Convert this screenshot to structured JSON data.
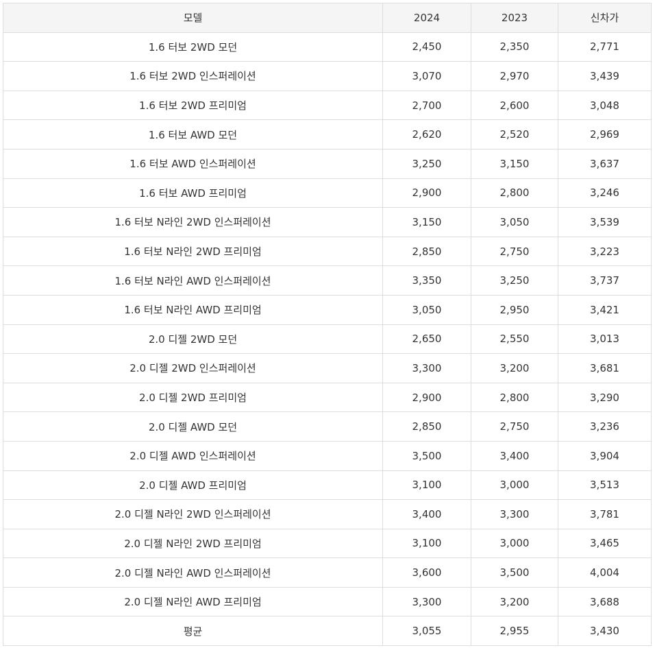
{
  "table": {
    "headers": [
      "모델",
      "2024",
      "2023",
      "신차가"
    ],
    "rows": [
      [
        "1.6 터보 2WD 모던",
        "2,450",
        "2,350",
        "2,771"
      ],
      [
        "1.6 터보 2WD 인스퍼레이션",
        "3,070",
        "2,970",
        "3,439"
      ],
      [
        "1.6 터보 2WD 프리미엄",
        "2,700",
        "2,600",
        "3,048"
      ],
      [
        "1.6 터보 AWD 모던",
        "2,620",
        "2,520",
        "2,969"
      ],
      [
        "1.6 터보 AWD 인스퍼레이션",
        "3,250",
        "3,150",
        "3,637"
      ],
      [
        "1.6 터보 AWD 프리미엄",
        "2,900",
        "2,800",
        "3,246"
      ],
      [
        "1.6 터보 N라인 2WD 인스퍼레이션",
        "3,150",
        "3,050",
        "3,539"
      ],
      [
        "1.6 터보 N라인 2WD 프리미엄",
        "2,850",
        "2,750",
        "3,223"
      ],
      [
        "1.6 터보 N라인 AWD 인스퍼레이션",
        "3,350",
        "3,250",
        "3,737"
      ],
      [
        "1.6 터보 N라인 AWD 프리미엄",
        "3,050",
        "2,950",
        "3,421"
      ],
      [
        "2.0 디젤 2WD 모던",
        "2,650",
        "2,550",
        "3,013"
      ],
      [
        "2.0 디젤 2WD 인스퍼레이션",
        "3,300",
        "3,200",
        "3,681"
      ],
      [
        "2.0 디젤 2WD 프리미엄",
        "2,900",
        "2,800",
        "3,290"
      ],
      [
        "2.0 디젤 AWD 모던",
        "2,850",
        "2,750",
        "3,236"
      ],
      [
        "2.0 디젤 AWD 인스퍼레이션",
        "3,500",
        "3,400",
        "3,904"
      ],
      [
        "2.0 디젤 AWD 프리미엄",
        "3,100",
        "3,000",
        "3,513"
      ],
      [
        "2.0 디젤 N라인 2WD 인스퍼레이션",
        "3,400",
        "3,300",
        "3,781"
      ],
      [
        "2.0 디젤 N라인 2WD 프리미엄",
        "3,100",
        "3,000",
        "3,465"
      ],
      [
        "2.0 디젤 N라인 AWD 인스퍼레이션",
        "3,600",
        "3,500",
        "4,004"
      ],
      [
        "2.0 디젤 N라인 AWD 프리미엄",
        "3,300",
        "3,200",
        "3,688"
      ],
      [
        "평균",
        "3,055",
        "2,955",
        "3,430"
      ]
    ]
  }
}
